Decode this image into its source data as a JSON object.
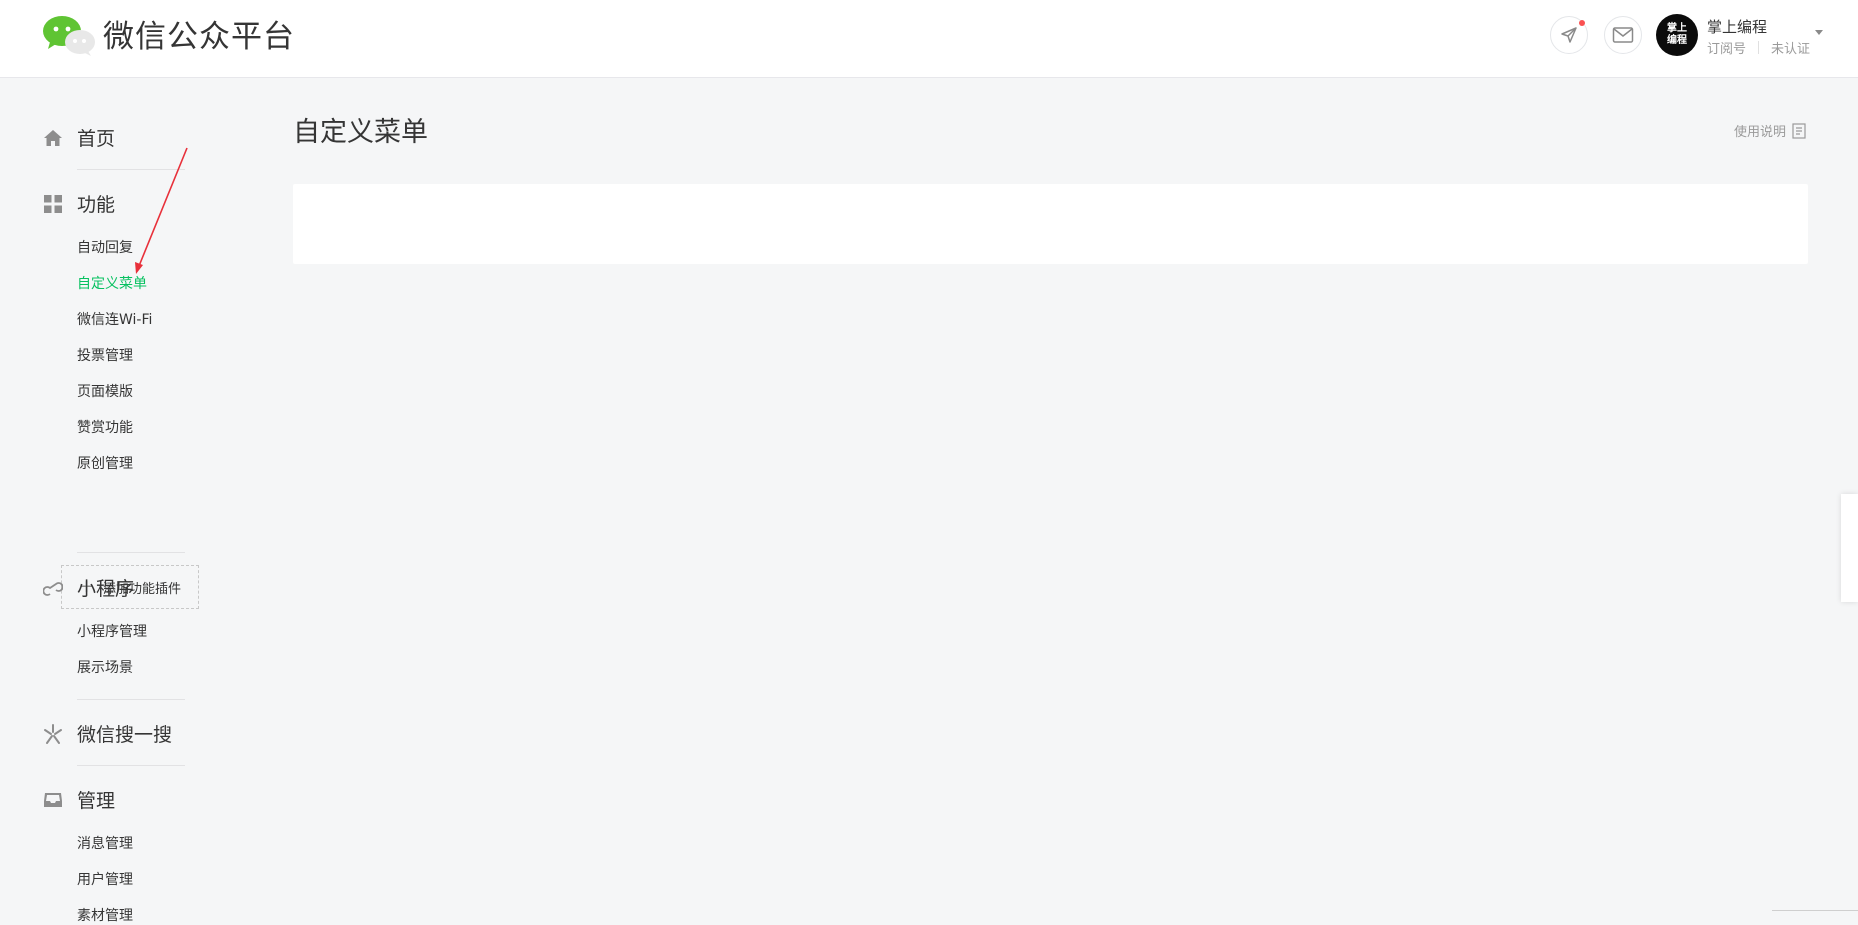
{
  "header": {
    "brand": "微信公众平台",
    "account": {
      "avatar_text_top": "掌上",
      "avatar_text_bottom": "编程",
      "name": "掌上编程",
      "type": "订阅号",
      "status": "未认证"
    },
    "notification_dot_color": "#fa5151"
  },
  "sidebar": {
    "sections": [
      {
        "label": "首页",
        "icon": "home-icon"
      },
      {
        "label": "功能",
        "icon": "grid-icon",
        "items": [
          "自动回复",
          "自定义菜单",
          "微信连Wi-Fi",
          "投票管理",
          "页面模版",
          "赞赏功能",
          "原创管理"
        ],
        "add_plugin": "添加功能插件"
      },
      {
        "label": "小程序",
        "icon": "link-icon",
        "items": [
          "小程序管理",
          "展示场景"
        ]
      },
      {
        "label": "微信搜一搜",
        "icon": "search-spark-icon"
      },
      {
        "label": "管理",
        "icon": "inbox-icon",
        "items": [
          "消息管理",
          "用户管理",
          "素材管理"
        ]
      }
    ],
    "active_item": "自定义菜单",
    "active_color": "#07c160"
  },
  "main": {
    "title": "自定义菜单",
    "help_link": "使用说明"
  }
}
